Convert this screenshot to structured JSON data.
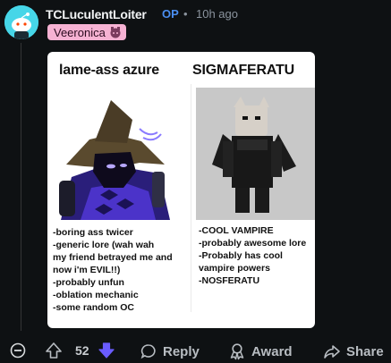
{
  "comment": {
    "username": "TCLuculentLoiter",
    "op_badge": "OP",
    "separator": "•",
    "time": "10h ago",
    "flair": "Veeronica"
  },
  "card": {
    "left_title": "lame-ass azure",
    "right_title": "SIGMAFERATU",
    "left_list": [
      "-boring ass twicer",
      "-generic lore (wah wah",
      "my friend betrayed me and",
      "now i'm EVIL!!)",
      "-probably unfun",
      "-oblation mechanic",
      "-some random OC"
    ],
    "right_list": [
      "-COOL VAMPIRE",
      "-probably awesome lore",
      "-Probably has cool",
      "vampire powers",
      "-NOSFERATU"
    ]
  },
  "actions": {
    "vote_count": "52",
    "reply_label": "Reply",
    "award_label": "Award",
    "share_label": "Share"
  },
  "colors": {
    "background": "#0e1113",
    "op_blue": "#4a8ef0",
    "flair_pink": "#f6b2d3",
    "downvote_active": "#6a5cff"
  }
}
